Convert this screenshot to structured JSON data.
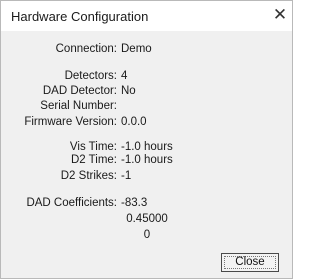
{
  "window": {
    "title": "Hardware Configuration",
    "close_glyph": "✕"
  },
  "fields": {
    "connection": {
      "label": "Connection:",
      "value": "Demo"
    },
    "detectors": {
      "label": "Detectors:",
      "value": "4"
    },
    "dad_detector": {
      "label": "DAD Detector:",
      "value": "No"
    },
    "serial_number": {
      "label": "Serial Number:",
      "value": ""
    },
    "firmware_version": {
      "label": "Firmware Version:",
      "value": "0.0.0"
    },
    "vis_time": {
      "label": "Vis Time:",
      "value": "-1.0 hours"
    },
    "d2_time": {
      "label": "D2 Time:",
      "value": "-1.0 hours"
    },
    "d2_strikes": {
      "label": "D2 Strikes:",
      "value": "-1"
    },
    "dad_coefficients": {
      "label": "DAD Coefficients:",
      "values": [
        "-83.3",
        "0.45000",
        "0"
      ]
    }
  },
  "buttons": {
    "close_label": "Close"
  }
}
